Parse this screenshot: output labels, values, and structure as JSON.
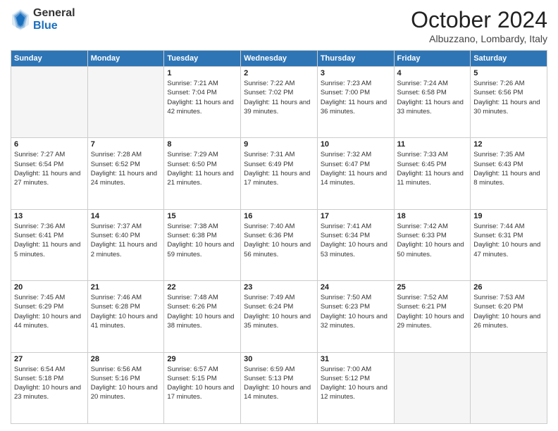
{
  "logo": {
    "general": "General",
    "blue": "Blue"
  },
  "header": {
    "month_title": "October 2024",
    "location": "Albuzzano, Lombardy, Italy"
  },
  "weekdays": [
    "Sunday",
    "Monday",
    "Tuesday",
    "Wednesday",
    "Thursday",
    "Friday",
    "Saturday"
  ],
  "weeks": [
    [
      {
        "day": "",
        "sunrise": "",
        "sunset": "",
        "daylight": ""
      },
      {
        "day": "",
        "sunrise": "",
        "sunset": "",
        "daylight": ""
      },
      {
        "day": "1",
        "sunrise": "Sunrise: 7:21 AM",
        "sunset": "Sunset: 7:04 PM",
        "daylight": "Daylight: 11 hours and 42 minutes."
      },
      {
        "day": "2",
        "sunrise": "Sunrise: 7:22 AM",
        "sunset": "Sunset: 7:02 PM",
        "daylight": "Daylight: 11 hours and 39 minutes."
      },
      {
        "day": "3",
        "sunrise": "Sunrise: 7:23 AM",
        "sunset": "Sunset: 7:00 PM",
        "daylight": "Daylight: 11 hours and 36 minutes."
      },
      {
        "day": "4",
        "sunrise": "Sunrise: 7:24 AM",
        "sunset": "Sunset: 6:58 PM",
        "daylight": "Daylight: 11 hours and 33 minutes."
      },
      {
        "day": "5",
        "sunrise": "Sunrise: 7:26 AM",
        "sunset": "Sunset: 6:56 PM",
        "daylight": "Daylight: 11 hours and 30 minutes."
      }
    ],
    [
      {
        "day": "6",
        "sunrise": "Sunrise: 7:27 AM",
        "sunset": "Sunset: 6:54 PM",
        "daylight": "Daylight: 11 hours and 27 minutes."
      },
      {
        "day": "7",
        "sunrise": "Sunrise: 7:28 AM",
        "sunset": "Sunset: 6:52 PM",
        "daylight": "Daylight: 11 hours and 24 minutes."
      },
      {
        "day": "8",
        "sunrise": "Sunrise: 7:29 AM",
        "sunset": "Sunset: 6:50 PM",
        "daylight": "Daylight: 11 hours and 21 minutes."
      },
      {
        "day": "9",
        "sunrise": "Sunrise: 7:31 AM",
        "sunset": "Sunset: 6:49 PM",
        "daylight": "Daylight: 11 hours and 17 minutes."
      },
      {
        "day": "10",
        "sunrise": "Sunrise: 7:32 AM",
        "sunset": "Sunset: 6:47 PM",
        "daylight": "Daylight: 11 hours and 14 minutes."
      },
      {
        "day": "11",
        "sunrise": "Sunrise: 7:33 AM",
        "sunset": "Sunset: 6:45 PM",
        "daylight": "Daylight: 11 hours and 11 minutes."
      },
      {
        "day": "12",
        "sunrise": "Sunrise: 7:35 AM",
        "sunset": "Sunset: 6:43 PM",
        "daylight": "Daylight: 11 hours and 8 minutes."
      }
    ],
    [
      {
        "day": "13",
        "sunrise": "Sunrise: 7:36 AM",
        "sunset": "Sunset: 6:41 PM",
        "daylight": "Daylight: 11 hours and 5 minutes."
      },
      {
        "day": "14",
        "sunrise": "Sunrise: 7:37 AM",
        "sunset": "Sunset: 6:40 PM",
        "daylight": "Daylight: 11 hours and 2 minutes."
      },
      {
        "day": "15",
        "sunrise": "Sunrise: 7:38 AM",
        "sunset": "Sunset: 6:38 PM",
        "daylight": "Daylight: 10 hours and 59 minutes."
      },
      {
        "day": "16",
        "sunrise": "Sunrise: 7:40 AM",
        "sunset": "Sunset: 6:36 PM",
        "daylight": "Daylight: 10 hours and 56 minutes."
      },
      {
        "day": "17",
        "sunrise": "Sunrise: 7:41 AM",
        "sunset": "Sunset: 6:34 PM",
        "daylight": "Daylight: 10 hours and 53 minutes."
      },
      {
        "day": "18",
        "sunrise": "Sunrise: 7:42 AM",
        "sunset": "Sunset: 6:33 PM",
        "daylight": "Daylight: 10 hours and 50 minutes."
      },
      {
        "day": "19",
        "sunrise": "Sunrise: 7:44 AM",
        "sunset": "Sunset: 6:31 PM",
        "daylight": "Daylight: 10 hours and 47 minutes."
      }
    ],
    [
      {
        "day": "20",
        "sunrise": "Sunrise: 7:45 AM",
        "sunset": "Sunset: 6:29 PM",
        "daylight": "Daylight: 10 hours and 44 minutes."
      },
      {
        "day": "21",
        "sunrise": "Sunrise: 7:46 AM",
        "sunset": "Sunset: 6:28 PM",
        "daylight": "Daylight: 10 hours and 41 minutes."
      },
      {
        "day": "22",
        "sunrise": "Sunrise: 7:48 AM",
        "sunset": "Sunset: 6:26 PM",
        "daylight": "Daylight: 10 hours and 38 minutes."
      },
      {
        "day": "23",
        "sunrise": "Sunrise: 7:49 AM",
        "sunset": "Sunset: 6:24 PM",
        "daylight": "Daylight: 10 hours and 35 minutes."
      },
      {
        "day": "24",
        "sunrise": "Sunrise: 7:50 AM",
        "sunset": "Sunset: 6:23 PM",
        "daylight": "Daylight: 10 hours and 32 minutes."
      },
      {
        "day": "25",
        "sunrise": "Sunrise: 7:52 AM",
        "sunset": "Sunset: 6:21 PM",
        "daylight": "Daylight: 10 hours and 29 minutes."
      },
      {
        "day": "26",
        "sunrise": "Sunrise: 7:53 AM",
        "sunset": "Sunset: 6:20 PM",
        "daylight": "Daylight: 10 hours and 26 minutes."
      }
    ],
    [
      {
        "day": "27",
        "sunrise": "Sunrise: 6:54 AM",
        "sunset": "Sunset: 5:18 PM",
        "daylight": "Daylight: 10 hours and 23 minutes."
      },
      {
        "day": "28",
        "sunrise": "Sunrise: 6:56 AM",
        "sunset": "Sunset: 5:16 PM",
        "daylight": "Daylight: 10 hours and 20 minutes."
      },
      {
        "day": "29",
        "sunrise": "Sunrise: 6:57 AM",
        "sunset": "Sunset: 5:15 PM",
        "daylight": "Daylight: 10 hours and 17 minutes."
      },
      {
        "day": "30",
        "sunrise": "Sunrise: 6:59 AM",
        "sunset": "Sunset: 5:13 PM",
        "daylight": "Daylight: 10 hours and 14 minutes."
      },
      {
        "day": "31",
        "sunrise": "Sunrise: 7:00 AM",
        "sunset": "Sunset: 5:12 PM",
        "daylight": "Daylight: 10 hours and 12 minutes."
      },
      {
        "day": "",
        "sunrise": "",
        "sunset": "",
        "daylight": ""
      },
      {
        "day": "",
        "sunrise": "",
        "sunset": "",
        "daylight": ""
      }
    ]
  ]
}
